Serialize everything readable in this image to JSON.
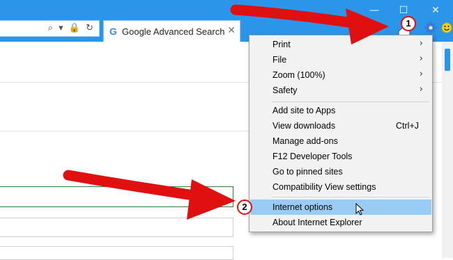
{
  "window": {
    "minimize": "—",
    "maximize": "☐",
    "close": "✕"
  },
  "address_bar": {
    "icons": "⌕ ▾ 🔒 ↻"
  },
  "tab": {
    "favicon": "G",
    "title": "Google Advanced Search",
    "close": "✕"
  },
  "toolbar": {
    "home_icon": "home-icon",
    "favorites_icon": "star-icon",
    "tools_icon": "gear-icon",
    "feedback_icon": "smiley-icon"
  },
  "menu": {
    "items": [
      {
        "label": "Print",
        "arrow": "›"
      },
      {
        "label": "File",
        "arrow": "›"
      },
      {
        "label": "Zoom (100%)",
        "arrow": "›"
      },
      {
        "label": "Safety",
        "arrow": "›"
      },
      {
        "label": "Add site to Apps"
      },
      {
        "label": "View downloads",
        "shortcut": "Ctrl+J"
      },
      {
        "label": "Manage add-ons"
      },
      {
        "label": "F12 Developer Tools"
      },
      {
        "label": "Go to pinned sites"
      },
      {
        "label": "Compatibility View settings"
      },
      {
        "label": "Internet options"
      },
      {
        "label": "About Internet Explorer"
      }
    ]
  },
  "callouts": {
    "step1": "1",
    "step2": "2"
  },
  "colors": {
    "title_bar": "#2b95e9",
    "highlight": "#99ccf5",
    "arrow": "#e01010"
  }
}
